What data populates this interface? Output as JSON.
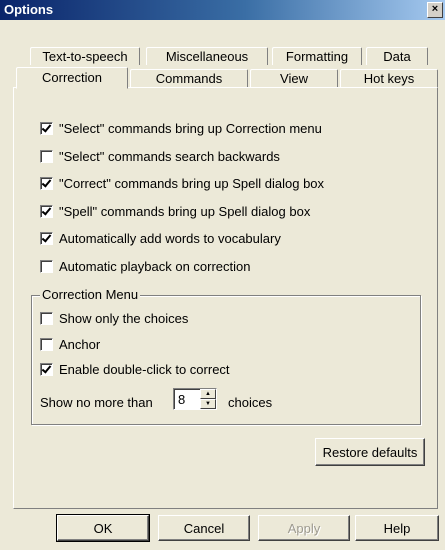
{
  "window": {
    "title": "Options",
    "close_glyph": "×"
  },
  "tabs": {
    "row_top": [
      "Text-to-speech",
      "Miscellaneous",
      "Formatting",
      "Data"
    ],
    "row_bottom": [
      "Correction",
      "Commands",
      "View",
      "Hot keys"
    ],
    "active": "Correction"
  },
  "options": [
    {
      "label": "\"Select\" commands bring up Correction menu",
      "checked": true
    },
    {
      "label": "\"Select\" commands search backwards",
      "checked": false
    },
    {
      "label": "\"Correct\" commands bring up Spell dialog box",
      "checked": true
    },
    {
      "label": "\"Spell\" commands bring up Spell dialog box",
      "checked": true
    },
    {
      "label": "Automatically add words to vocabulary",
      "checked": true
    },
    {
      "label": "Automatic playback on correction",
      "checked": false
    }
  ],
  "correction_menu": {
    "title": "Correction Menu",
    "options": [
      {
        "label": "Show only the choices",
        "checked": false
      },
      {
        "label": "Anchor",
        "checked": false
      },
      {
        "label": "Enable double-click to correct",
        "checked": true
      }
    ],
    "show_no_more_than_label": "Show no more than",
    "choices_value": "8",
    "choices_label": "choices"
  },
  "buttons": {
    "restore_defaults": "Restore defaults",
    "ok": "OK",
    "cancel": "Cancel",
    "apply": "Apply",
    "help": "Help"
  }
}
